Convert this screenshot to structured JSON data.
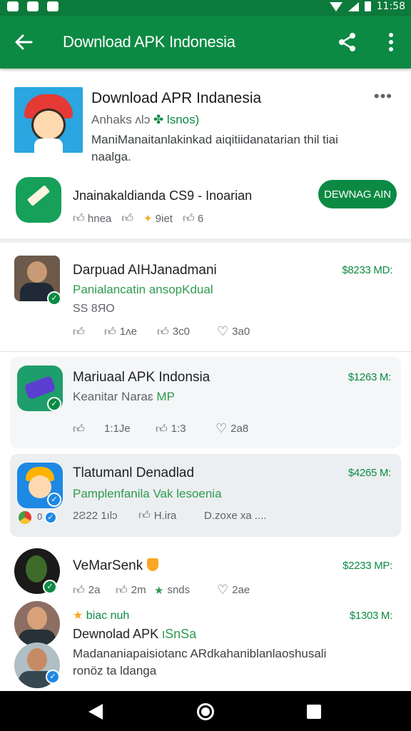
{
  "status_bar": {
    "time": "11:58"
  },
  "app_bar": {
    "title": "Download APK Indonesia"
  },
  "featured": {
    "title": "Download APR Indanesia",
    "subtitle_a": "Anhaks ᴧlɔ",
    "subtitle_b": "lsnos)",
    "description": "ManiManaitanlakinkad aiqitiidanatarian thil tiai naalga."
  },
  "app_row": {
    "title": "Jnainakaldianda CS9 - Inoarian",
    "meta": [
      {
        "icon": "thumbs-up-icon",
        "text": "hnea"
      },
      {
        "icon": "thumbs-up-icon",
        "text": ""
      },
      {
        "icon": "star-icon",
        "text": "9iet"
      },
      {
        "icon": "thumbs-up-icon",
        "text": "6"
      }
    ],
    "button_label": "DEWNAG AIN"
  },
  "list": [
    {
      "title": "Darpuad AIHJanadmani",
      "subtitle": "Panialancatin ansopKdual",
      "extra": "SS 8ЯO",
      "price": "$8233 MD:",
      "meta": [
        "",
        "1ʌe",
        "3c0",
        "3a0"
      ]
    },
    {
      "title": "Mariuaal APK Indonsia",
      "subtitle_grey": "Keanitar Naraɛ",
      "subtitle_green": "MP",
      "price": "$1263 M:",
      "meta": [
        "",
        "1:1Je",
        "1:3",
        "2a8"
      ]
    },
    {
      "title": "Tlatumanl Denadlad",
      "subtitle": "Pamplenfanila Vak lesoenia",
      "price": "$4265 M:",
      "meta": [
        "0",
        "2Ƨ22 1ılɔ",
        "H.ira",
        "D.zoxe xa ...."
      ]
    },
    {
      "title": "VeMarSenk",
      "price": "$2233 MP:",
      "meta": [
        "2a",
        "2m",
        "snds",
        "2ae"
      ]
    },
    {
      "tag": "biac nuh",
      "title": "Dewnolad APK",
      "title_green": "ιSnSa",
      "description": "Madananiapaisiotanc ARdkahaniblanlaoshusali ronöz ta ldanga",
      "price": "$1303 M:"
    }
  ],
  "colors": {
    "primary": "#0c8a43",
    "accent_star": "#f9a825"
  }
}
